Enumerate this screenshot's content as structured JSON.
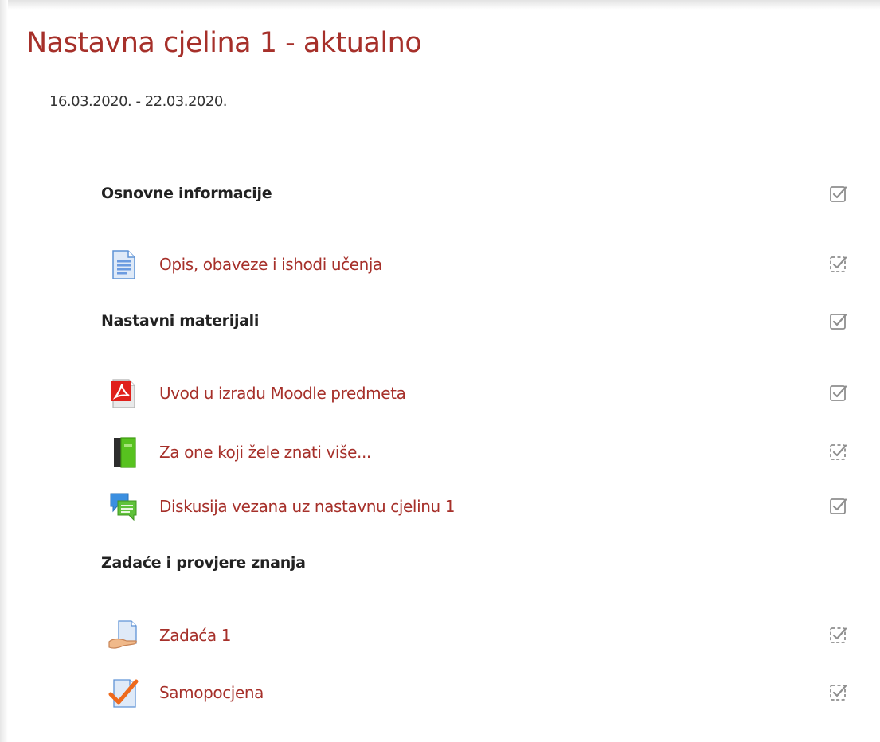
{
  "section": {
    "title": "Nastavna cjelina 1 - aktualno",
    "dates": "16.03.2020. - 22.03.2020."
  },
  "items": [
    {
      "kind": "heading",
      "text": "Osnovne informacije",
      "completion": "manual"
    },
    {
      "kind": "activity",
      "icon": "page-icon",
      "text": "Opis, obaveze i ishodi učenja",
      "completion": "auto"
    },
    {
      "kind": "heading",
      "text": "Nastavni materijali",
      "completion": "manual"
    },
    {
      "kind": "activity",
      "icon": "pdf-file-icon",
      "text": "Uvod u izradu Moodle predmeta",
      "completion": "manual"
    },
    {
      "kind": "activity",
      "icon": "book-icon",
      "text": "Za one koji žele znati više...",
      "completion": "auto"
    },
    {
      "kind": "activity",
      "icon": "forum-icon",
      "text": "Diskusija vezana uz nastavnu cjelinu 1",
      "completion": "manual"
    },
    {
      "kind": "heading",
      "text": "Zadaće i provjere znanja",
      "completion": "none"
    },
    {
      "kind": "activity",
      "icon": "assignment-icon",
      "text": "Zadaća 1",
      "completion": "auto"
    },
    {
      "kind": "activity",
      "icon": "quiz-icon",
      "text": "Samopocjena",
      "completion": "auto"
    }
  ],
  "colors": {
    "link": "#a6302a",
    "heading": "#222222",
    "check": "#8f8f8f"
  }
}
